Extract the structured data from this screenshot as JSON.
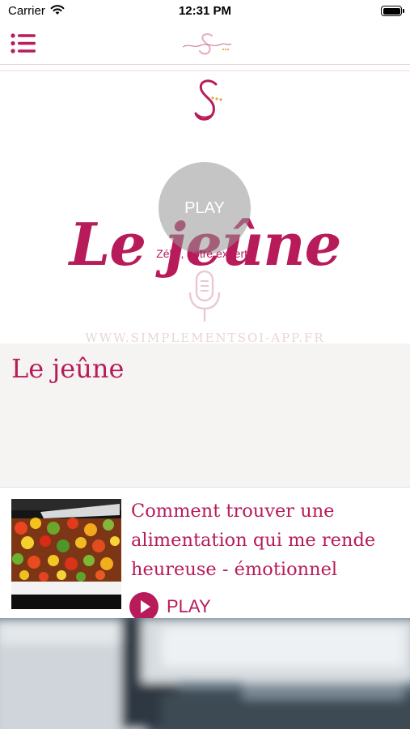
{
  "status_bar": {
    "carrier": "Carrier",
    "time": "12:31 PM",
    "wifi_icon": "wifi-icon",
    "battery_icon": "battery-icon"
  },
  "header": {
    "menu_icon": "list-menu-icon",
    "logo_text": "Simplement soi"
  },
  "hero": {
    "title": "Le jeûne",
    "play_label": "PLAY",
    "subtitle": "Zélie, notre experte",
    "url": "WWW.SIMPLEMENTSOI-APP.FR",
    "mic_icon": "microphone-icon"
  },
  "episode": {
    "title": "Le jeûne"
  },
  "list": {
    "items": [
      {
        "title": "Comment trouver une alimentation qui me rende heureuse - émotionnel",
        "play_label": "PLAY",
        "thumbnail": "vegetables-dish-thumbnail"
      }
    ]
  },
  "colors": {
    "brand": "#b81b5a",
    "panel": "#f5f4f2"
  }
}
